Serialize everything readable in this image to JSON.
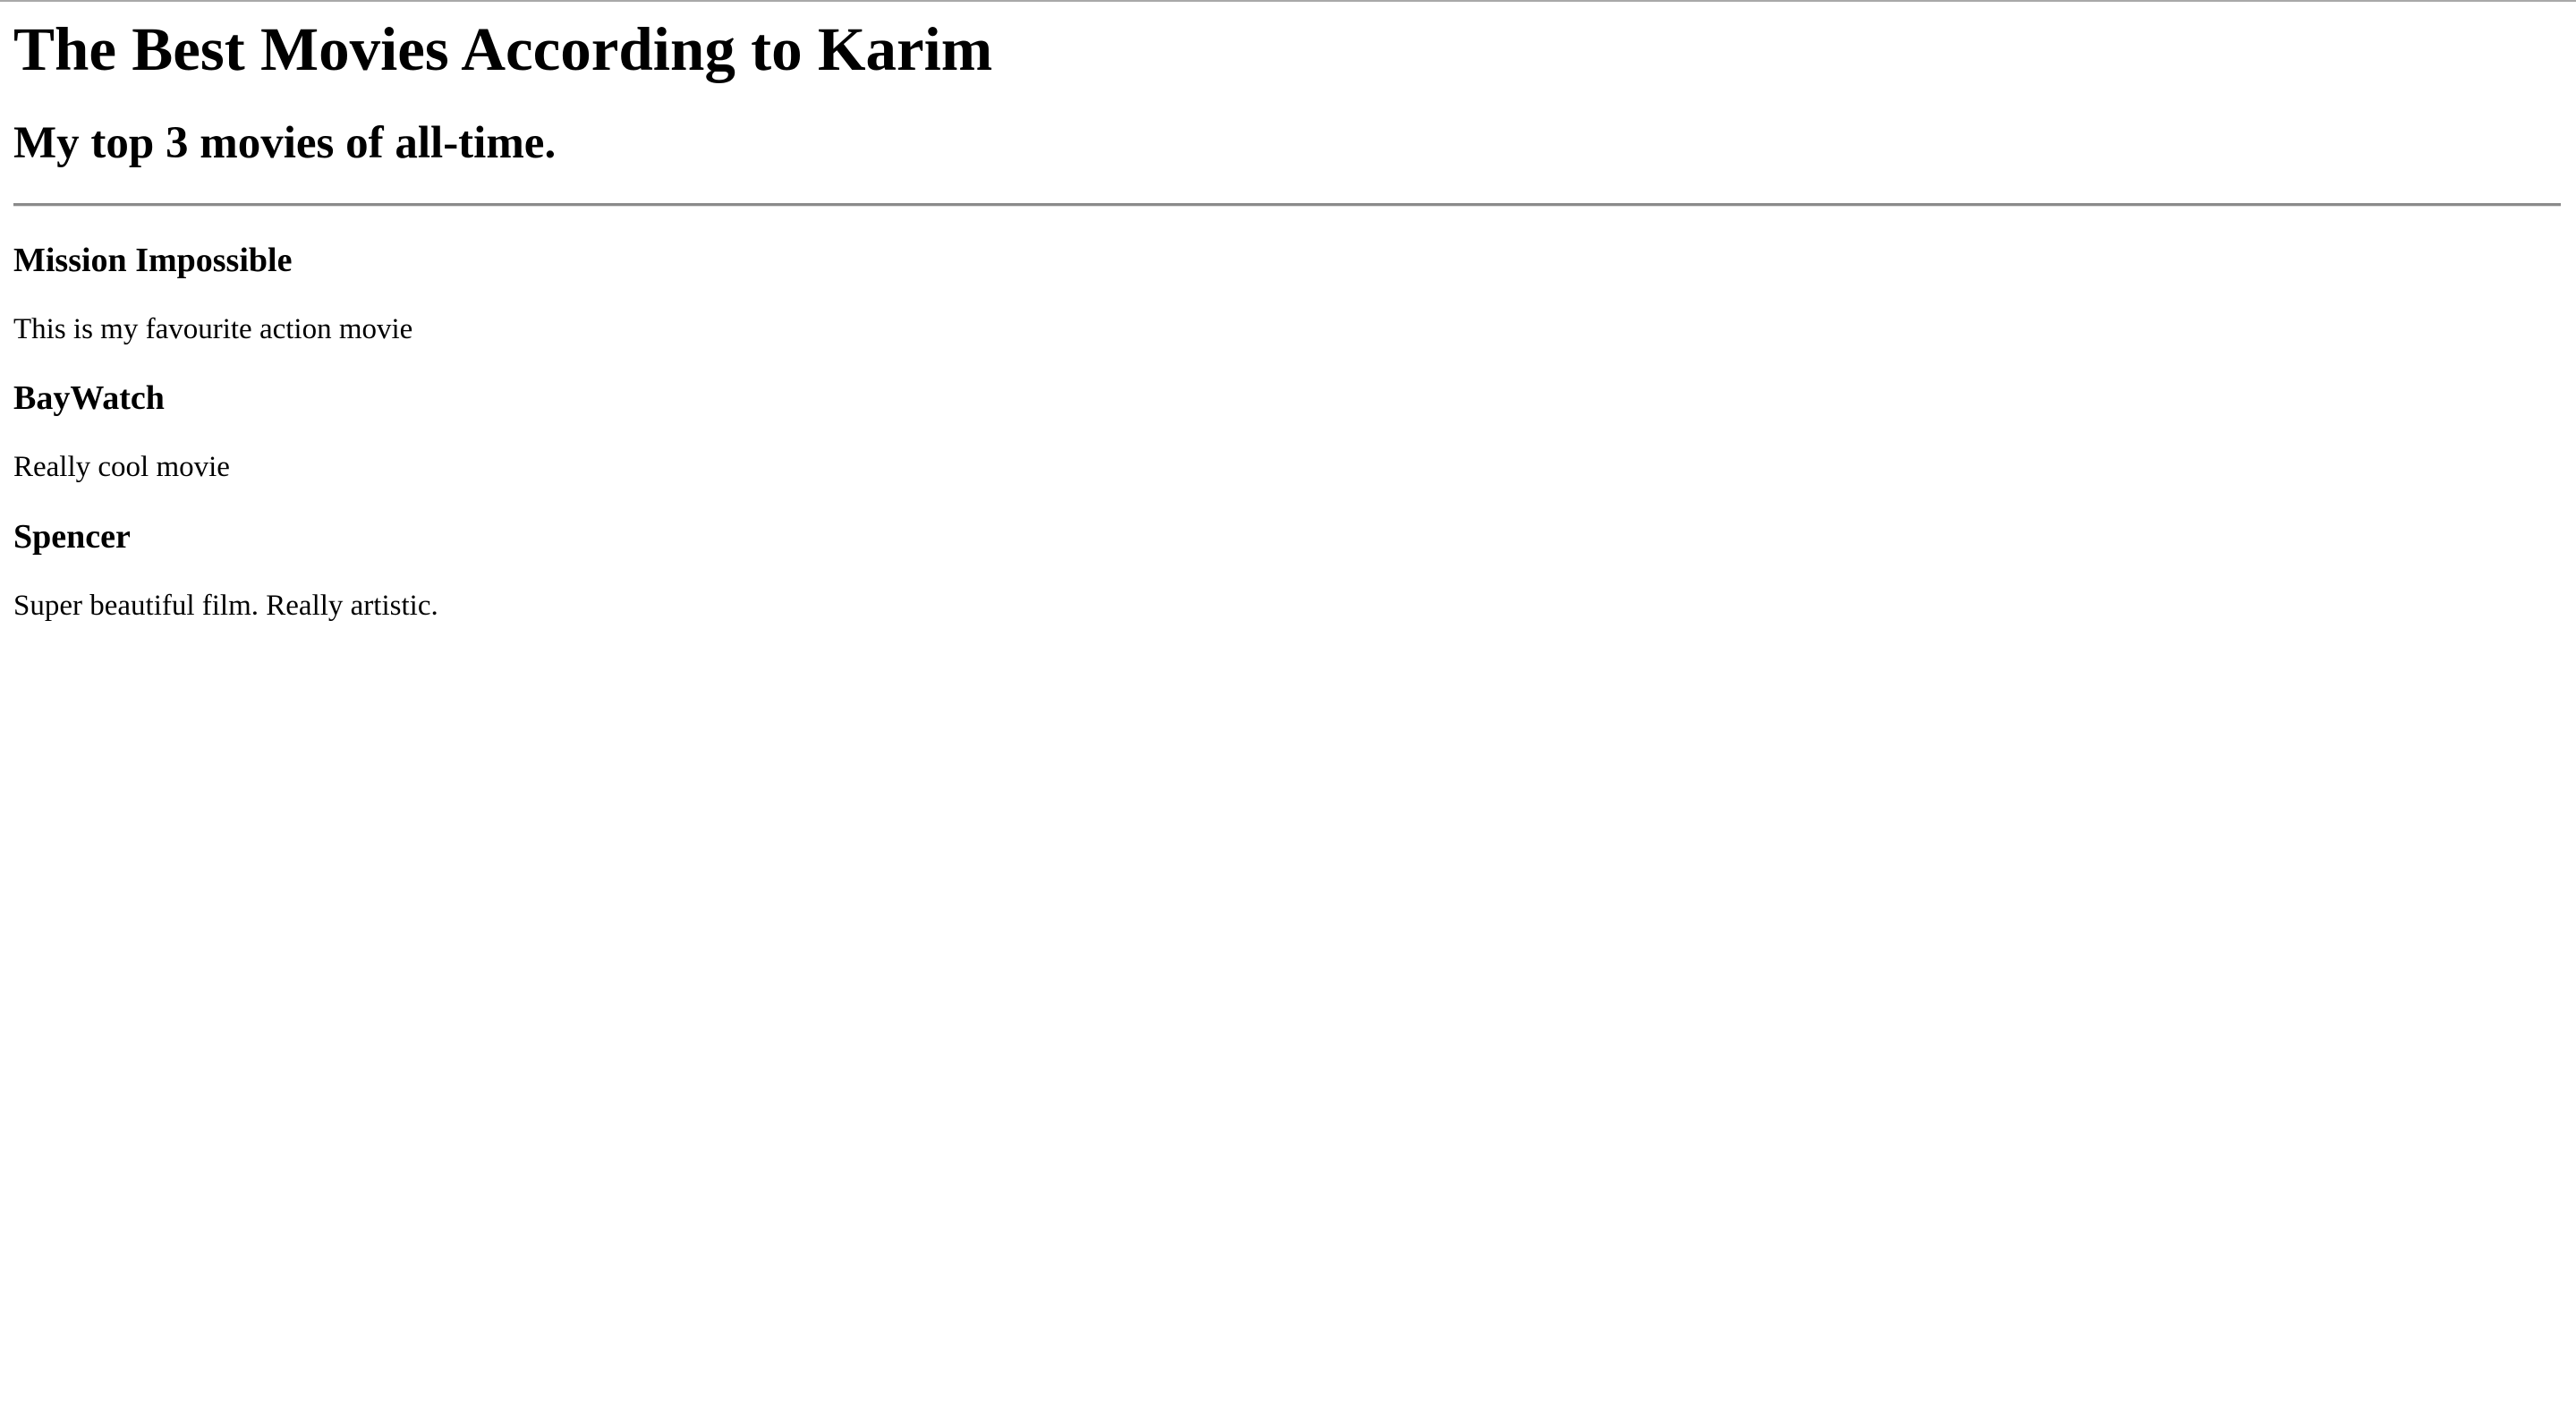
{
  "page": {
    "title": "The Best Movies According to Karim",
    "subtitle": "My top 3 movies of all-time."
  },
  "movies": [
    {
      "name": "Mission Impossible",
      "description": "This is my favourite action movie"
    },
    {
      "name": "BayWatch",
      "description": "Really cool movie"
    },
    {
      "name": "Spencer",
      "description": "Super beautiful film. Really artistic."
    }
  ]
}
